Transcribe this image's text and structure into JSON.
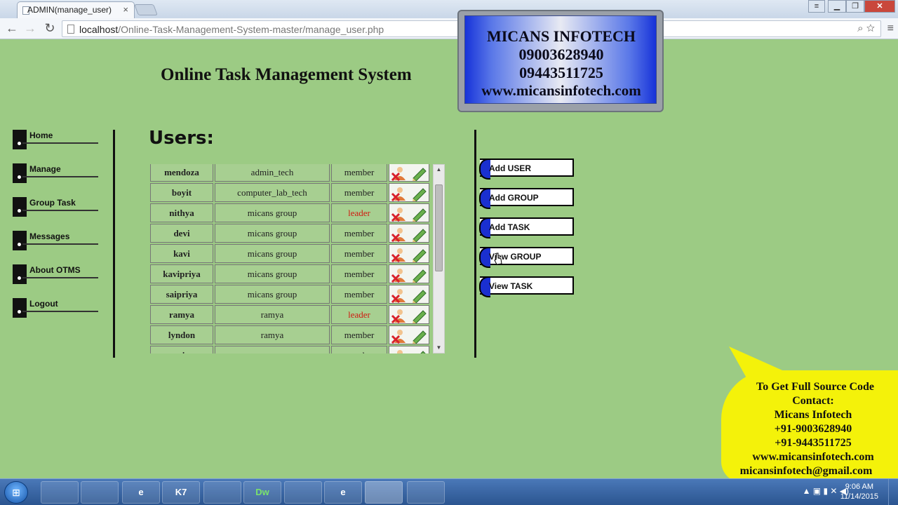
{
  "browser": {
    "tab_title": "ADMIN(manage_user)",
    "tab_close": "×",
    "url_host": "localhost",
    "url_path": "/Online-Task-Management-System-master/manage_user.php",
    "window_buttons": [
      "▁",
      "❐",
      "✕"
    ],
    "user_button": "≡",
    "back": "←",
    "forward": "→",
    "reload": "↻",
    "zoom_icon_glyph": "⌕",
    "star_icon_glyph": "☆",
    "menu_icon_glyph": "≡"
  },
  "page": {
    "site_title": "Online Task Management System",
    "users_heading": "Users:"
  },
  "sidebar": {
    "items": [
      {
        "label": "Home"
      },
      {
        "label": "Manage"
      },
      {
        "label": "Group Task"
      },
      {
        "label": "Messages"
      },
      {
        "label": "About OTMS"
      },
      {
        "label": "Logout"
      }
    ]
  },
  "users_table": {
    "rows": [
      {
        "name": "mendoza",
        "group": "admin_tech",
        "role": "member"
      },
      {
        "name": "boyit",
        "group": "computer_lab_tech",
        "role": "member"
      },
      {
        "name": "nithya",
        "group": "micans group",
        "role": "leader"
      },
      {
        "name": "devi",
        "group": "micans group",
        "role": "member"
      },
      {
        "name": "kavi",
        "group": "micans group",
        "role": "member"
      },
      {
        "name": "kavipriya",
        "group": "micans group",
        "role": "member"
      },
      {
        "name": "saipriya",
        "group": "micans group",
        "role": "member"
      },
      {
        "name": "ramya",
        "group": "ramya",
        "role": "leader"
      },
      {
        "name": "lyndon",
        "group": "ramya",
        "role": "member"
      },
      {
        "name": "mic",
        "group": "ramya",
        "role": "member"
      }
    ],
    "leader_color": "#d01a10"
  },
  "actions": {
    "buttons": [
      {
        "label": "Add USER"
      },
      {
        "label": "Add GROUP"
      },
      {
        "label": "Add TASK"
      },
      {
        "label": "View GROUP"
      },
      {
        "label": "View TASK"
      }
    ]
  },
  "banner": {
    "company": "MICANS INFOTECH",
    "phone1": "09003628940",
    "phone2": "09443511725",
    "website": "www.micansinfotech.com"
  },
  "contact_bubble": {
    "line1": "To Get Full Source Code",
    "line2": "Contact:",
    "line3": "Micans Infotech",
    "line4": "+91-9003628940",
    "line5": "+91-9443511725",
    "line6": "www.micansinfotech.com",
    "line7": "micansinfotech@gmail.com"
  },
  "taskbar": {
    "start_glyph": "⊞",
    "apps": [
      "",
      "",
      "e",
      "K7",
      "",
      "Dw",
      "",
      "e",
      "",
      ""
    ],
    "time": "9:06 AM",
    "date": "11/14/2015",
    "tray_glyphs": "▲ ▣ ▮ ✕ ◀)"
  },
  "colors": {
    "page_bg": "#9ccb84",
    "button_accent": "#1a2fd0",
    "bubble": "#f4f20a"
  }
}
